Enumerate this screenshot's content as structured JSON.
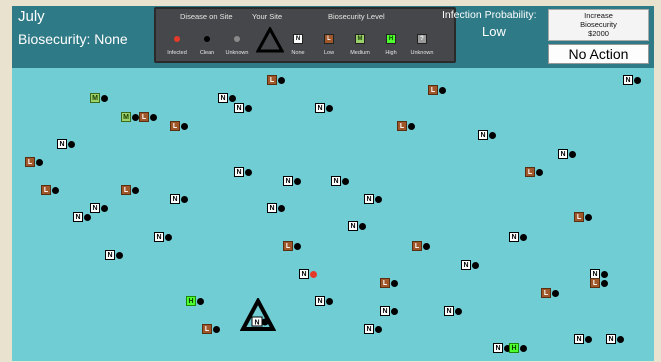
{
  "header": {
    "month": "July",
    "biosecurity_label": "Biosecurity: None",
    "infection_prob_label": "Infection Probability:",
    "infection_prob_value": "Low",
    "increase_button": {
      "line1": "Increase",
      "line2": "Biosecurity",
      "line3": "$2000"
    },
    "no_action_button": "No Action"
  },
  "legend": {
    "disease_heading": "Disease on Site",
    "your_site_heading": "Your Site",
    "biosecurity_heading": "Biosecurity Level",
    "disease_items": [
      {
        "label": "Infected",
        "color": "#e53a2a"
      },
      {
        "label": "Clean",
        "color": "#000000"
      },
      {
        "label": "Unknown",
        "color": "#8a8a8a"
      }
    ],
    "level_items": [
      {
        "code": "N",
        "label": "None"
      },
      {
        "code": "L",
        "label": "Low"
      },
      {
        "code": "M",
        "label": "Medium"
      },
      {
        "code": "H",
        "label": "High"
      },
      {
        "code": "?",
        "label": "Unknown"
      }
    ]
  },
  "your_site": {
    "level": "N",
    "status": "clean"
  },
  "sites": [
    {
      "level": "L",
      "status": "clean"
    },
    {
      "level": "N",
      "status": "clean"
    },
    {
      "level": "M",
      "status": "clean"
    },
    {
      "level": "N",
      "status": "clean"
    },
    {
      "level": "N",
      "status": "clean"
    },
    {
      "level": "N",
      "status": "clean"
    },
    {
      "level": "L",
      "status": "clean"
    },
    {
      "level": "M",
      "status": "clean"
    },
    {
      "level": "L",
      "status": "clean"
    },
    {
      "level": "L",
      "status": "clean"
    },
    {
      "level": "L",
      "status": "clean"
    },
    {
      "level": "N",
      "status": "clean"
    },
    {
      "level": "N",
      "status": "clean"
    },
    {
      "level": "N",
      "status": "clean"
    },
    {
      "level": "L",
      "status": "clean"
    },
    {
      "level": "N",
      "status": "clean"
    },
    {
      "level": "N",
      "status": "clean"
    },
    {
      "level": "N",
      "status": "clean"
    },
    {
      "level": "L",
      "status": "clean"
    },
    {
      "level": "L",
      "status": "clean"
    },
    {
      "level": "L",
      "status": "clean"
    },
    {
      "level": "N",
      "status": "clean"
    },
    {
      "level": "N",
      "status": "clean"
    },
    {
      "level": "N",
      "status": "clean"
    },
    {
      "level": "N",
      "status": "clean"
    },
    {
      "level": "N",
      "status": "clean"
    },
    {
      "level": "L",
      "status": "clean"
    },
    {
      "level": "N",
      "status": "clean"
    },
    {
      "level": "N",
      "status": "clean"
    },
    {
      "level": "N",
      "status": "clean"
    },
    {
      "level": "L",
      "status": "clean"
    },
    {
      "level": "L",
      "status": "clean"
    },
    {
      "level": "N",
      "status": "clean"
    },
    {
      "level": "N",
      "status": "clean"
    },
    {
      "level": "N",
      "status": "infected"
    },
    {
      "level": "L",
      "status": "clean"
    },
    {
      "level": "N",
      "status": "clean"
    },
    {
      "level": "L",
      "status": "clean"
    },
    {
      "level": "L",
      "status": "clean"
    },
    {
      "level": "H",
      "status": "clean"
    },
    {
      "level": "N",
      "status": "clean"
    },
    {
      "level": "N",
      "status": "clean"
    },
    {
      "level": "N",
      "status": "clean"
    },
    {
      "level": "L",
      "status": "clean"
    },
    {
      "level": "N",
      "status": "clean"
    },
    {
      "level": "N",
      "status": "clean"
    },
    {
      "level": "H",
      "status": "clean"
    },
    {
      "level": "N",
      "status": "clean"
    },
    {
      "level": "N",
      "status": "clean"
    },
    {
      "level": "N",
      "status": "clean"
    }
  ]
}
